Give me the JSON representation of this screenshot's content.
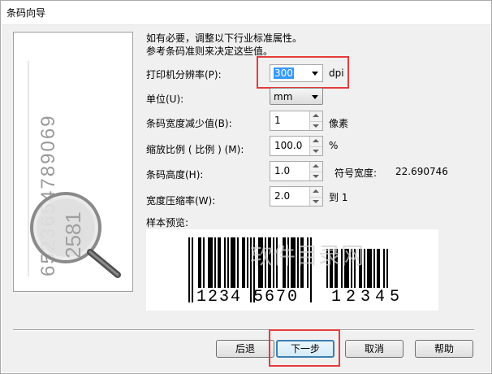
{
  "window": {
    "title": "条码向导"
  },
  "intro": {
    "line1": "如有必要，调整以下行业标准属性。",
    "line2": "参考条码准则来决定这些值。"
  },
  "fields": {
    "printer_resolution": {
      "label": "打印机分辨率(P):",
      "value": "300",
      "unit": "dpi"
    },
    "unit": {
      "label": "单位(U):",
      "value": "mm"
    },
    "width_reduction": {
      "label": "条码宽度减少值(B):",
      "value": "1",
      "unit": "像素"
    },
    "scale": {
      "label": "缩放比例 ( 比例 ) (M):",
      "value": "100.0",
      "unit": "%"
    },
    "height": {
      "label": "条码高度(H):",
      "value": "1.0"
    },
    "symbol_width": {
      "label": "符号宽度:",
      "value": "22.690746"
    },
    "compression": {
      "label": "宽度压缩率(W):",
      "value": "2.0",
      "unit": "到 1"
    }
  },
  "preview": {
    "label": "样本预览:",
    "main_digits": "1234 5670",
    "addon_digits": "12345",
    "watermark": "软件目录网"
  },
  "side_image": {
    "digits": "6523654789069"
  },
  "buttons": {
    "back": "后退",
    "next": "下一步",
    "cancel": "取消",
    "help": "帮助"
  },
  "colors": {
    "highlight": "#e53b3b",
    "selection": "#3399ff",
    "default_button": "#3c7fb1"
  }
}
